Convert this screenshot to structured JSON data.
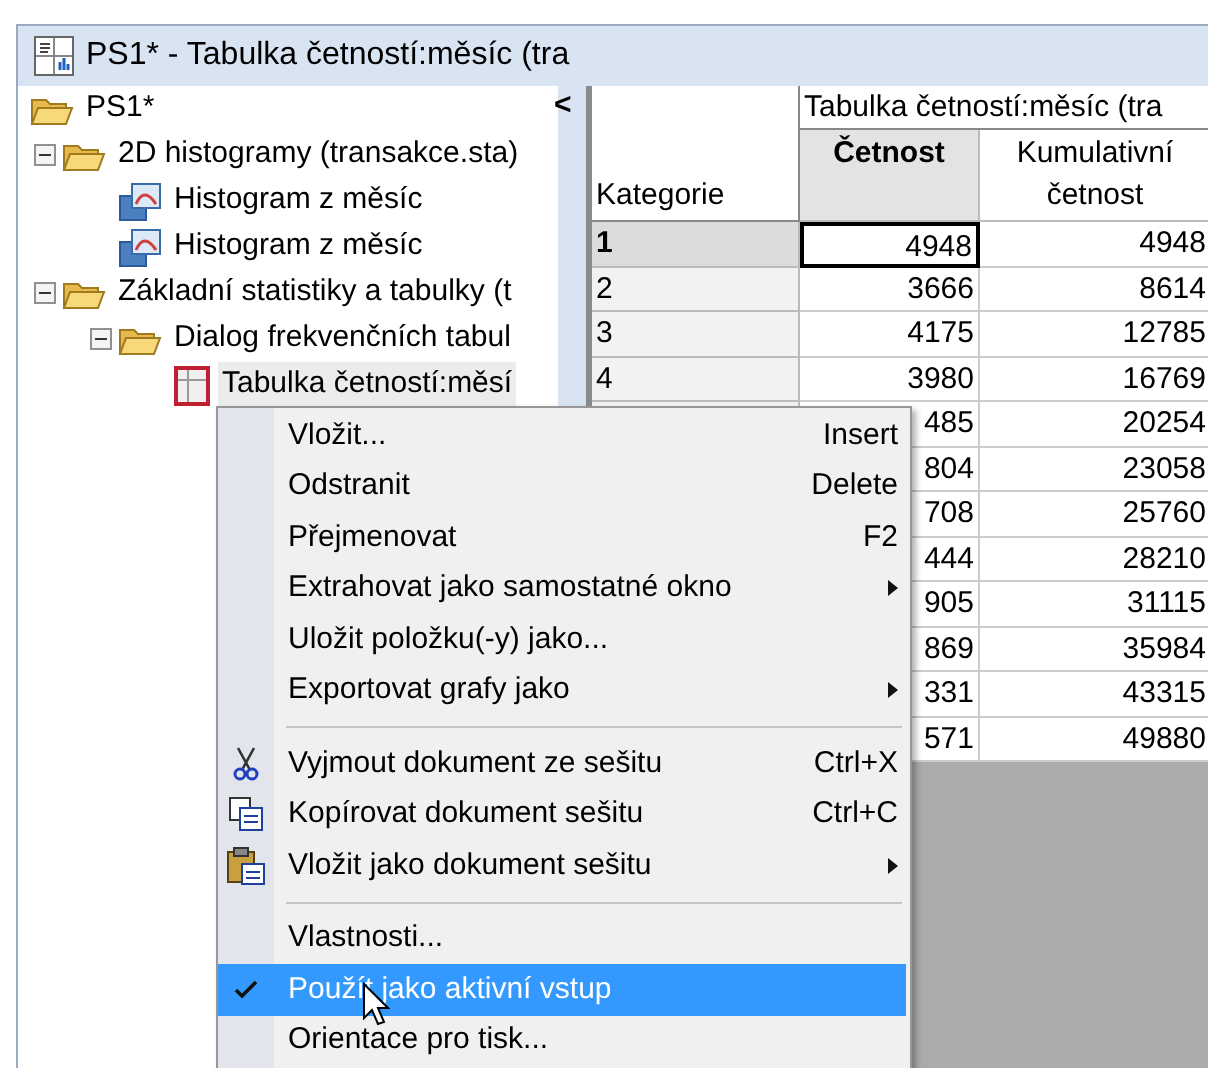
{
  "window": {
    "title": "PS1* - Tabulka četností:měsíc (tra"
  },
  "splitter": {
    "label": "<"
  },
  "tree": [
    {
      "label": "PS1*",
      "kind": "folder",
      "selected": false,
      "children": [
        {
          "label": "2D histogramy (transakce.sta)",
          "kind": "folder",
          "expanded": true,
          "selected": false,
          "children": [
            {
              "label": "Histogram z měsíc",
              "kind": "graph",
              "selected": false
            },
            {
              "label": "Histogram z měsíc",
              "kind": "graph",
              "selected": false
            }
          ]
        },
        {
          "label": "Základní statistiky a tabulky (t",
          "kind": "folder",
          "expanded": true,
          "selected": false,
          "children": [
            {
              "label": "Dialog frekvenčních tabul",
              "kind": "folder",
              "expanded": true,
              "selected": false,
              "children": [
                {
                  "label": "Tabulka četností:měsí",
                  "kind": "table",
                  "selected": true
                }
              ]
            }
          ]
        }
      ]
    }
  ],
  "table": {
    "title": "Tabulka četností:měsíc (tra",
    "row_header": "Kategorie",
    "columns": [
      {
        "label": "Četnost",
        "selected": true
      },
      {
        "label": "Kumulativní četnost",
        "selected": false
      }
    ],
    "rows": [
      {
        "category": "1",
        "selected": true,
        "cells": [
          "4948",
          "4948"
        ]
      },
      {
        "category": "2",
        "selected": false,
        "cells": [
          "3666",
          "8614"
        ]
      },
      {
        "category": "3",
        "selected": false,
        "cells": [
          "4175",
          "12785"
        ]
      },
      {
        "category": "4",
        "selected": false,
        "cells": [
          "3980",
          "16769"
        ]
      },
      {
        "cells": [
          "485",
          "20254"
        ]
      },
      {
        "cells": [
          "804",
          "23058"
        ]
      },
      {
        "cells": [
          "708",
          "25760"
        ]
      },
      {
        "cells": [
          "444",
          "28210"
        ]
      },
      {
        "cells": [
          "905",
          "31115"
        ]
      },
      {
        "cells": [
          "869",
          "35984"
        ]
      },
      {
        "cells": [
          "331",
          "43315"
        ]
      },
      {
        "cells": [
          "571",
          "49880"
        ]
      }
    ]
  },
  "context_menu": [
    {
      "kind": "item",
      "label": "Vložit...",
      "shortcut": "Insert",
      "submenu": false,
      "checked": false,
      "selected": false
    },
    {
      "kind": "item",
      "label": "Odstranit",
      "shortcut": "Delete",
      "submenu": false,
      "checked": false,
      "selected": false
    },
    {
      "kind": "item",
      "label": "Přejmenovat",
      "shortcut": "F2",
      "submenu": false,
      "checked": false,
      "selected": false
    },
    {
      "kind": "item",
      "label": "Extrahovat jako samostatné okno",
      "submenu": true,
      "checked": false,
      "selected": false
    },
    {
      "kind": "item",
      "label": "Uložit položku(-y) jako...",
      "submenu": false,
      "checked": false,
      "selected": false
    },
    {
      "kind": "item",
      "label": "Exportovat grafy jako",
      "submenu": true,
      "checked": false,
      "selected": false
    },
    {
      "kind": "separator"
    },
    {
      "kind": "item",
      "label": "Vyjmout dokument ze sešitu",
      "shortcut": "Ctrl+X",
      "submenu": false,
      "checked": false,
      "selected": false
    },
    {
      "kind": "item",
      "label": "Kopírovat dokument sešitu",
      "shortcut": "Ctrl+C",
      "submenu": false,
      "checked": false,
      "selected": false
    },
    {
      "kind": "item",
      "label": "Vložit jako dokument sešitu",
      "submenu": true,
      "checked": false,
      "selected": false
    },
    {
      "kind": "separator"
    },
    {
      "kind": "item",
      "label": "Vlastnosti...",
      "submenu": false,
      "checked": false,
      "selected": false
    },
    {
      "kind": "item",
      "label": "Použít jako aktivní vstup",
      "submenu": false,
      "checked": true,
      "selected": true
    },
    {
      "kind": "item",
      "label": "Orientace pro tisk...",
      "submenu": false,
      "checked": false,
      "selected": false
    }
  ]
}
